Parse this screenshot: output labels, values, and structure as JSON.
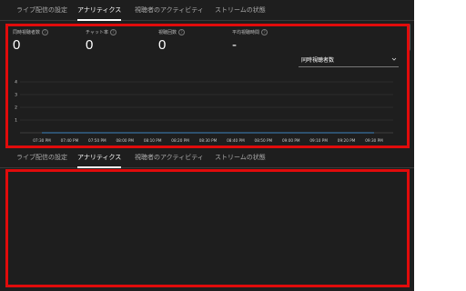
{
  "tabs_top": [
    "ライブ配信の設定",
    "アナリティクス",
    "視聴者のアクティビティ",
    "ストリームの状態"
  ],
  "tabs_bottom": [
    "ライブ配信の設定",
    "アナリティクス",
    "視聴者のアクティビティ",
    "ストリームの状態"
  ],
  "active_tab": "アナリティクス",
  "stats": [
    {
      "label": "同時視聴者数",
      "value": "0"
    },
    {
      "label": "チャット率",
      "value": "0"
    },
    {
      "label": "視聴回数",
      "value": "0"
    },
    {
      "label": "平均視聴時間",
      "value": "-"
    }
  ],
  "metric_select": {
    "value": "同時視聴者数",
    "icon": "chevron-down-icon"
  },
  "chart_data": {
    "type": "line",
    "yticks": [
      1,
      2,
      3,
      4
    ],
    "ylim": [
      0,
      4
    ],
    "categories": [
      "07:30 PM",
      "07:40 PM",
      "07:50 PM",
      "08:00 PM",
      "08:10 PM",
      "08:20 PM",
      "08:30 PM",
      "08:40 PM",
      "08:50 PM",
      "09:00 PM",
      "09:10 PM",
      "09:20 PM",
      "09:30 PM"
    ],
    "series": [
      {
        "values": [
          0,
          0,
          0,
          0,
          0,
          0,
          0,
          0,
          0,
          0,
          0,
          0,
          0
        ]
      }
    ],
    "grid": true
  },
  "colors": {
    "background": "#1e1e1e",
    "highlight": "#e10b0b",
    "text": "#ffffff"
  }
}
